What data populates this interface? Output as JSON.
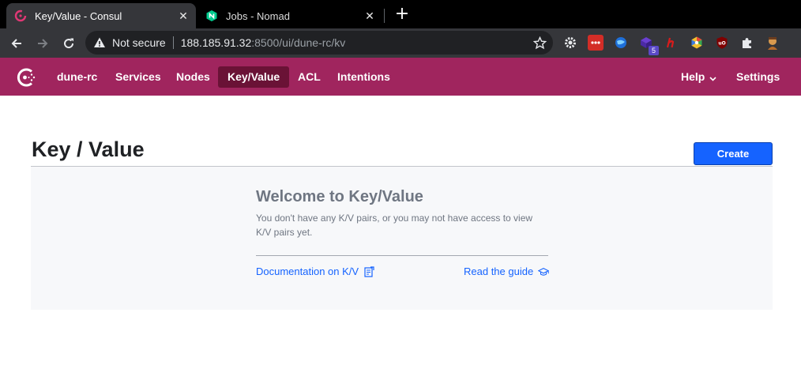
{
  "browser": {
    "tabs": [
      {
        "title": "Key/Value - Consul",
        "favicon": "consul-icon",
        "active": true
      },
      {
        "title": "Jobs - Nomad",
        "favicon": "nomad-icon",
        "active": false
      }
    ],
    "omnibox": {
      "security_label": "Not secure",
      "url_host": "188.185.91.32",
      "url_rest": ":8500/ui/dune-rc/kv"
    },
    "extensions": [
      "gear-icon",
      "lastpass-icon",
      "globe-icon",
      "cube-icon",
      "h-icon",
      "colorpicker-icon",
      "ublock-icon",
      "puzzle-icon",
      "avatar-icon"
    ],
    "extension_badge": "5"
  },
  "consul_nav": {
    "datacenter": "dune-rc",
    "items": [
      "Services",
      "Nodes",
      "Key/Value",
      "ACL",
      "Intentions"
    ],
    "active": "Key/Value",
    "help": "Help",
    "settings": "Settings"
  },
  "main": {
    "title": "Key / Value",
    "create_label": "Create",
    "empty": {
      "heading": "Welcome to Key/Value",
      "body": "You don't have any K/V pairs, or you may not have access to view K/V pairs yet.",
      "doc_link": "Documentation on K/V",
      "guide_link": "Read the guide"
    }
  },
  "colors": {
    "consul_brand": "#a0255e",
    "nav_active": "#6a1236",
    "primary_button": "#1563ff",
    "link": "#1563ff"
  }
}
